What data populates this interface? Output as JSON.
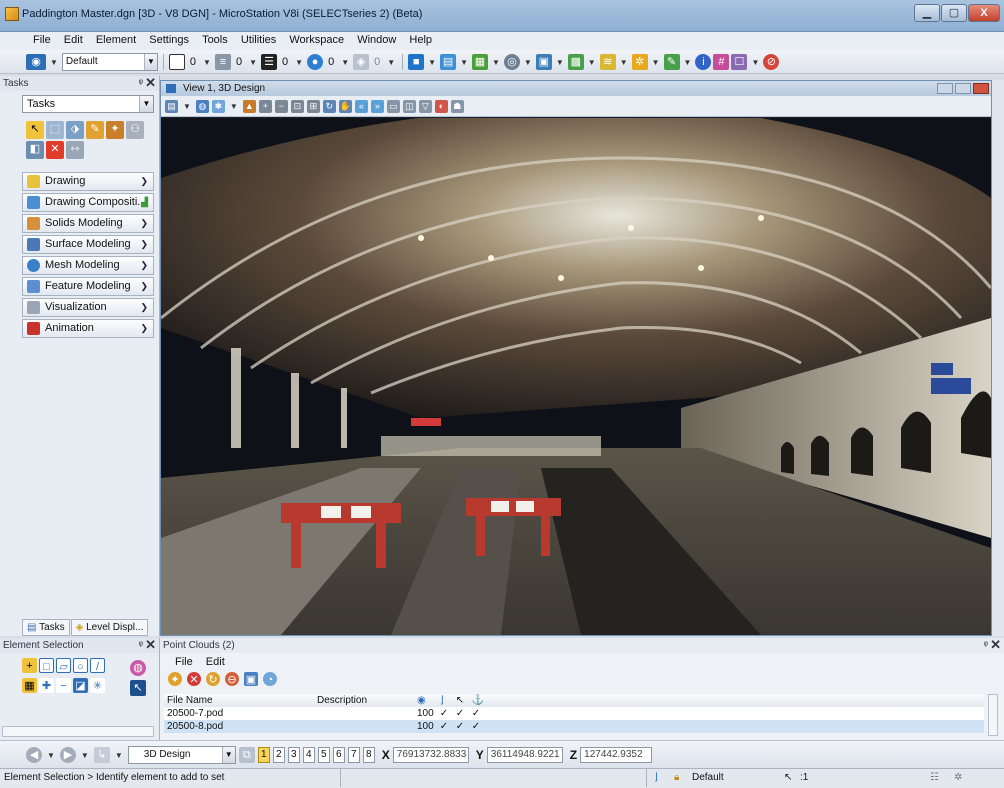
{
  "window": {
    "title": "Paddington Master.dgn [3D - V8 DGN] - MicroStation V8i (SELECTseries 2) (Beta)",
    "minimize": "▁",
    "maximize": "▢",
    "close": "X"
  },
  "menu": [
    "File",
    "Edit",
    "Element",
    "Settings",
    "Tools",
    "Utilities",
    "Workspace",
    "Window",
    "Help"
  ],
  "attributes_toolbar": {
    "level": "Default",
    "color": "0",
    "style": "0",
    "weight": "0",
    "transparency": "0",
    "priority": "0"
  },
  "tasks_panel": {
    "header": "Tasks",
    "selector": "Tasks",
    "groups": [
      "Drawing",
      "Drawing Compositi...",
      "Solids Modeling",
      "Surface Modeling",
      "Mesh Modeling",
      "Feature Modeling",
      "Visualization",
      "Animation"
    ],
    "tabs": [
      "Tasks",
      "Level Displ..."
    ]
  },
  "view": {
    "title": "View 1, 3D Design"
  },
  "element_selection": {
    "header": "Element Selection"
  },
  "point_clouds": {
    "header": "Point Clouds (2)",
    "menu": [
      "File",
      "Edit"
    ],
    "columns": [
      "File Name",
      "Description",
      "",
      "",
      "",
      ""
    ],
    "rows": [
      {
        "file": "20500-7.pod",
        "description": "",
        "density": "100",
        "c1": "✓",
        "c2": "✓",
        "c3": "✓"
      },
      {
        "file": "20500-8.pod",
        "description": "",
        "density": "100",
        "c1": "✓",
        "c2": "✓",
        "c3": "✓"
      }
    ]
  },
  "coordinates": {
    "view_type": "3D Design",
    "views": [
      "1",
      "2",
      "3",
      "4",
      "5",
      "6",
      "7",
      "8"
    ],
    "x_label": "X",
    "x": "76913732.8833",
    "y_label": "Y",
    "y": "36114948.9221",
    "z_label": "Z",
    "z": "127442.9352"
  },
  "status": {
    "message": "Element Selection > Identify element to add to set",
    "model": "Default",
    "selection_count": ":1"
  },
  "colors": {
    "title_bar": "#9fbbdb",
    "selected_row": "#cfe3f5",
    "close_button": "#c2402c"
  }
}
